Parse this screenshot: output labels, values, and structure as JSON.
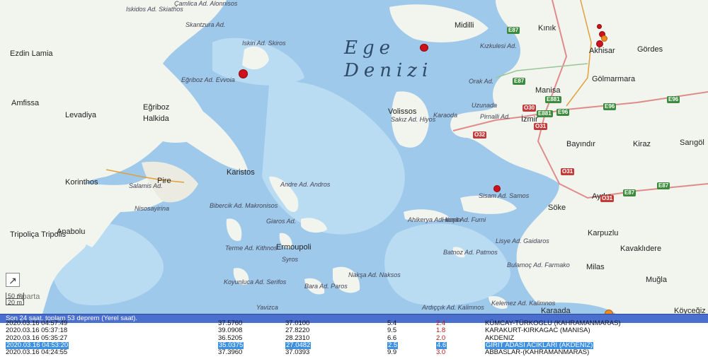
{
  "map": {
    "sea_label_line1": "Ege",
    "sea_label_line2": "Denizi",
    "place_labels": [
      "Iskidos Ad. Skiathos",
      "Çamlica Ad. Alonnisos",
      "Skantzura Ad.",
      "Iskiri Ad. Skiros",
      "Midilli",
      "Kınık",
      "Gördes",
      "Akhisar",
      "Kızkulesi Ad.",
      "Gölmarmara",
      "Ezdin Lamia",
      "Eğriboz Ad. Evvoia",
      "Amfissa",
      "Levadiya",
      "Eğriboz",
      "Halkida",
      "Volissos",
      "Sakız Ad. Hiyos",
      "Karaoda",
      "Orak Ad.",
      "Uzunada",
      "Pirnalli Ad.",
      "Manisa",
      "İzmir",
      "Bayındır",
      "Kiraz",
      "Sarıgöl",
      "Korinthos",
      "Salamis Ad.",
      "Pire",
      "Karistos",
      "Andre Ad. Andros",
      "Sisam Ad. Samos",
      "Söke",
      "Aydın",
      "Nisosayirina",
      "Bibercik Ad. Makronisos",
      "Ahikerya Ad. Ikaria",
      "Hurşit Ad. Furni",
      "Karpuzlu",
      "Tripoliça Tripolis",
      "Anabolu",
      "Giaros Ad.",
      "Ermoupoli",
      "Syros",
      "Terme Ad. Kithnos",
      "Kavaklıdere",
      "Batnoz Ad. Patmos",
      "Lisye Ad. Gaidaros",
      "Bulamoç Ad. Farmako",
      "Milas",
      "Muğla",
      "Koyunluca Ad. Serifos",
      "Bara Ad. Paros",
      "Nakşa Ad. Naksos",
      "Yavizca",
      "Ardıççık Ad. Kalimnos",
      "Kelemez Ad. Kalimnos",
      "Karaada",
      "Köyceğiz"
    ],
    "road_shields": [
      "E87",
      "E87",
      "E881",
      "O30",
      "E881",
      "E96",
      "E96",
      "E96",
      "O31",
      "O32",
      "O31",
      "O31",
      "E87",
      "E87"
    ],
    "expand_icon": "↗",
    "scale": {
      "top": "50 mi",
      "bottom": "20 m"
    },
    "watermark": "Sparta"
  },
  "table": {
    "header": "Son 24 saat, toplam 53 deprem (Yerel saat).",
    "rows": [
      {
        "date": "2020.03.16 04:57:49",
        "lat": "37.5760",
        "lon": "37.0100",
        "depth": "5.4",
        "mag": "2.4",
        "place": "KÜMCAY-TÜRKOGLU (KAHRAMANMARAS)",
        "selected": false
      },
      {
        "date": "2020.03.16 05:37:18",
        "lat": "39.0908",
        "lon": "27.8220",
        "depth": "9.5",
        "mag": "1.8",
        "place": "KARAKURT-KIRKAGAC (MANISA)",
        "selected": false
      },
      {
        "date": "2020.03.16 05:35:27",
        "lat": "36.5205",
        "lon": "28.2310",
        "depth": "6.6",
        "mag": "2.0",
        "place": "AKDENIZ",
        "selected": false
      },
      {
        "date": "2020.03.16 04:53:20",
        "lat": "35.0375",
        "lon": "27.0482",
        "depth": "2.5",
        "mag": "4.6",
        "place": "GIRIT ADASI ACIKLARI (AKDENIZ)",
        "selected": true
      },
      {
        "date": "2020.03.16 04:24:55",
        "lat": "37.3960",
        "lon": "37.0393",
        "depth": "9.9",
        "mag": "3.0",
        "place": "ABBASLAR-(KAHRAMANMARAS)",
        "selected": false
      }
    ]
  },
  "colors": {
    "sea": "#9ec9ea",
    "sea_shallow": "#b9dcf3",
    "land": "#f2f4ee",
    "highlight": "#3d8fe0",
    "header_bar": "#4b6fcf",
    "quake": "#d0101a"
  }
}
